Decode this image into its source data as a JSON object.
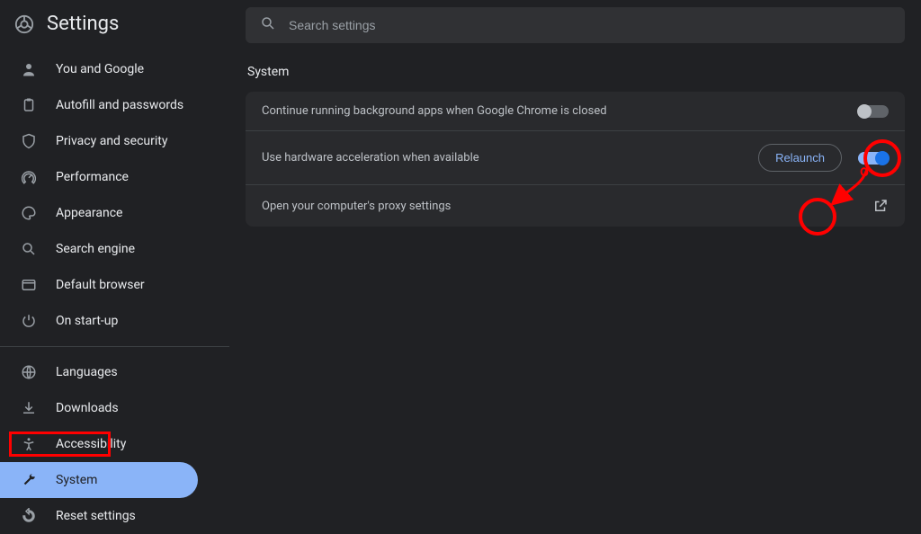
{
  "header": {
    "title": "Settings"
  },
  "search": {
    "placeholder": "Search settings"
  },
  "sidebar": {
    "items_top": [
      {
        "label": "You and Google",
        "icon": "person"
      },
      {
        "label": "Autofill and passwords",
        "icon": "clipboard"
      },
      {
        "label": "Privacy and security",
        "icon": "shield"
      },
      {
        "label": "Performance",
        "icon": "speed"
      },
      {
        "label": "Appearance",
        "icon": "palette"
      },
      {
        "label": "Search engine",
        "icon": "search"
      },
      {
        "label": "Default browser",
        "icon": "browser"
      },
      {
        "label": "On start-up",
        "icon": "power"
      }
    ],
    "items_bottom": [
      {
        "label": "Languages",
        "icon": "globe"
      },
      {
        "label": "Downloads",
        "icon": "download"
      },
      {
        "label": "Accessibility",
        "icon": "accessibility"
      },
      {
        "label": "System",
        "icon": "wrench",
        "active": true
      },
      {
        "label": "Reset settings",
        "icon": "reset"
      }
    ]
  },
  "section": {
    "title": "System",
    "rows": {
      "r0": {
        "label": "Continue running background apps when Google Chrome is closed",
        "toggle": "off"
      },
      "r1": {
        "label": "Use hardware acceleration when available",
        "toggle": "on",
        "action_label": "Relaunch"
      },
      "r2": {
        "label": "Open your computer's proxy settings"
      }
    }
  },
  "annotations": {
    "highlight_system": true,
    "circle_toggle_on": true,
    "circle_floating_toggle_off": true,
    "arrow_from_on_to_off": true
  }
}
